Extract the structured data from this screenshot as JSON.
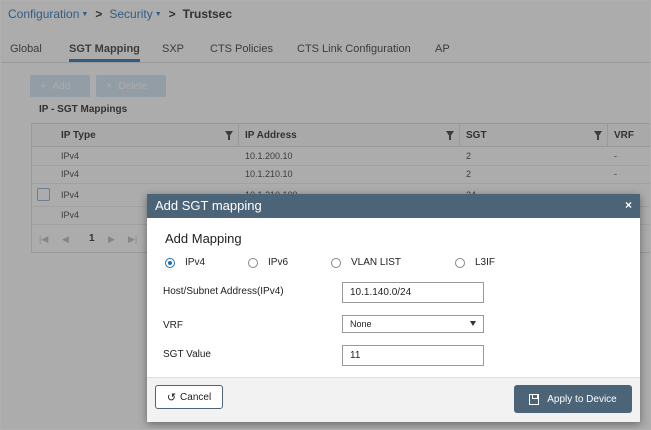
{
  "breadcrumb": {
    "items": [
      "Configuration",
      "Security"
    ],
    "current": "Trustsec"
  },
  "tabs": [
    "Global",
    "SGT Mapping",
    "SXP",
    "CTS Policies",
    "CTS Link Configuration",
    "AP"
  ],
  "active_tab": "SGT Mapping",
  "toolbar": {
    "add_label": "Add",
    "delete_label": "Delete"
  },
  "section_title": "IP - SGT Mappings",
  "table": {
    "columns": [
      "IP Type",
      "IP Address",
      "SGT",
      "VRF"
    ],
    "rows": [
      [
        "IPv4",
        "10.1.200.10",
        "2",
        "-"
      ],
      [
        "IPv4",
        "10.1.210.10",
        "2",
        "-"
      ],
      [
        "IPv4",
        "10.1.210.100",
        "34",
        "-"
      ],
      [
        "IPv4",
        "",
        "",
        ""
      ]
    ],
    "current_page": "1"
  },
  "modal": {
    "title": "Add SGT mapping",
    "close_glyph": "×",
    "subtitle": "Add Mapping",
    "ip_type_options": [
      "IPv4",
      "IPv6",
      "VLAN LIST",
      "L3IF"
    ],
    "selected_ip_type": "IPv4",
    "host_label": "Host/Subnet Address(IPv4)",
    "host_value": "10.1.140.0/24",
    "vrf_label": "VRF",
    "vrf_value": "None",
    "sgt_label": "SGT Value",
    "sgt_value": "11",
    "cancel_label": "Cancel",
    "apply_label": "Apply to Device"
  },
  "colors": {
    "accent": "#1f6fb5",
    "modal_header": "#4c6478"
  }
}
